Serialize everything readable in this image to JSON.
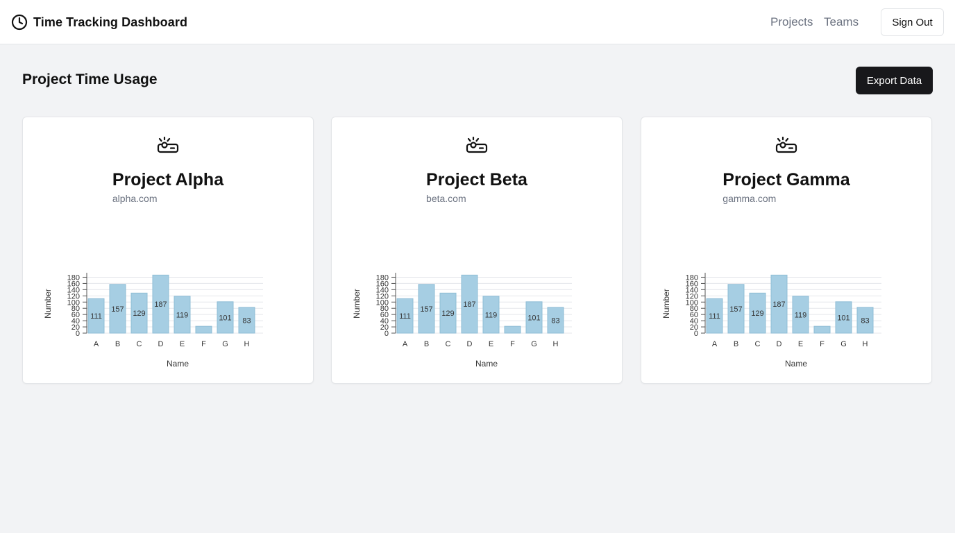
{
  "header": {
    "title": "Time Tracking Dashboard",
    "logo_icon": "clock-icon",
    "nav": [
      {
        "label": "Projects"
      },
      {
        "label": "Teams"
      }
    ],
    "sign_out_label": "Sign Out"
  },
  "main": {
    "page_title": "Project Time Usage",
    "export_label": "Export Data"
  },
  "projects": [
    {
      "icon": "projector-icon",
      "name": "Project Alpha",
      "domain": "alpha.com"
    },
    {
      "icon": "projector-icon",
      "name": "Project Beta",
      "domain": "beta.com"
    },
    {
      "icon": "projector-icon",
      "name": "Project Gamma",
      "domain": "gamma.com"
    }
  ],
  "colors": {
    "bar_fill": "#a6cee3",
    "bar_stroke": "#8fbdd6",
    "primary_button": "#18181b"
  },
  "chart_data": [
    {
      "type": "bar",
      "categories": [
        "A",
        "B",
        "C",
        "D",
        "E",
        "F",
        "G",
        "H"
      ],
      "values": [
        111,
        157,
        129,
        187,
        119,
        22,
        101,
        83
      ],
      "xlabel": "Name",
      "ylabel": "Number",
      "yticks": [
        0,
        20,
        40,
        60,
        80,
        100,
        120,
        140,
        160,
        180
      ],
      "ylim": [
        0,
        190
      ],
      "grid": true,
      "data_labels_shown": [
        true,
        true,
        true,
        true,
        true,
        false,
        true,
        true
      ]
    },
    {
      "type": "bar",
      "categories": [
        "A",
        "B",
        "C",
        "D",
        "E",
        "F",
        "G",
        "H"
      ],
      "values": [
        111,
        157,
        129,
        187,
        119,
        22,
        101,
        83
      ],
      "xlabel": "Name",
      "ylabel": "Number",
      "yticks": [
        0,
        20,
        40,
        60,
        80,
        100,
        120,
        140,
        160,
        180
      ],
      "ylim": [
        0,
        190
      ],
      "grid": true,
      "data_labels_shown": [
        true,
        true,
        true,
        true,
        true,
        false,
        true,
        true
      ]
    },
    {
      "type": "bar",
      "categories": [
        "A",
        "B",
        "C",
        "D",
        "E",
        "F",
        "G",
        "H"
      ],
      "values": [
        111,
        157,
        129,
        187,
        119,
        22,
        101,
        83
      ],
      "xlabel": "Name",
      "ylabel": "Number",
      "yticks": [
        0,
        20,
        40,
        60,
        80,
        100,
        120,
        140,
        160,
        180
      ],
      "ylim": [
        0,
        190
      ],
      "grid": true,
      "data_labels_shown": [
        true,
        true,
        true,
        true,
        true,
        false,
        true,
        true
      ]
    }
  ]
}
